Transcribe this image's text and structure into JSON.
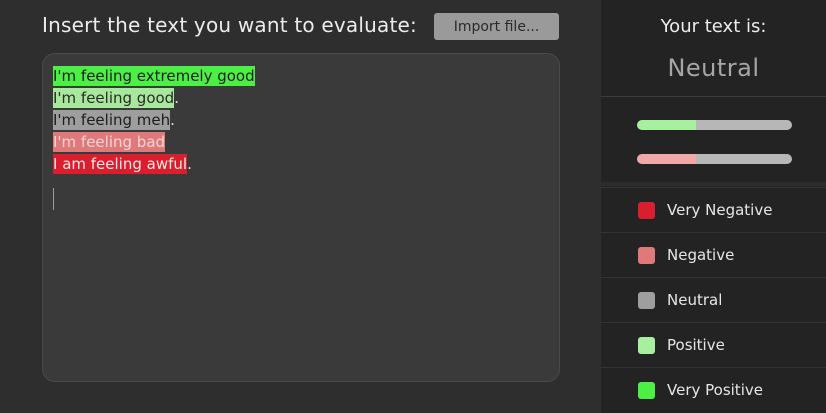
{
  "header": {
    "title": "Insert the text you want to evaluate:",
    "import_button": "Import file..."
  },
  "editor": {
    "lines": [
      {
        "highlighted": "I'm feeling extremely good",
        "suffix": "",
        "sentiment": "very-positive"
      },
      {
        "highlighted": "I'm feeling good",
        "suffix": ".",
        "sentiment": "positive"
      },
      {
        "highlighted": "I'm feeling meh",
        "suffix": ".",
        "sentiment": "neutral"
      },
      {
        "highlighted": "I'm feeling bad",
        "suffix": "",
        "sentiment": "negative"
      },
      {
        "highlighted": "I am feeling awful",
        "suffix": ".",
        "sentiment": "very-negative"
      }
    ]
  },
  "result": {
    "label": "Your text is:",
    "value": "Neutral"
  },
  "bars": [
    {
      "name": "positive",
      "level": 0.38,
      "color": "#a8f0a0"
    },
    {
      "name": "negative",
      "level": 0.38,
      "color": "#f2a8a8"
    }
  ],
  "legend": [
    {
      "label": "Very Negative",
      "color": "#d91f2d"
    },
    {
      "label": "Negative",
      "color": "#e07a7a"
    },
    {
      "label": "Neutral",
      "color": "#9e9e9e"
    },
    {
      "label": "Positive",
      "color": "#a8f0a0"
    },
    {
      "label": "Very Positive",
      "color": "#4cf044"
    }
  ]
}
